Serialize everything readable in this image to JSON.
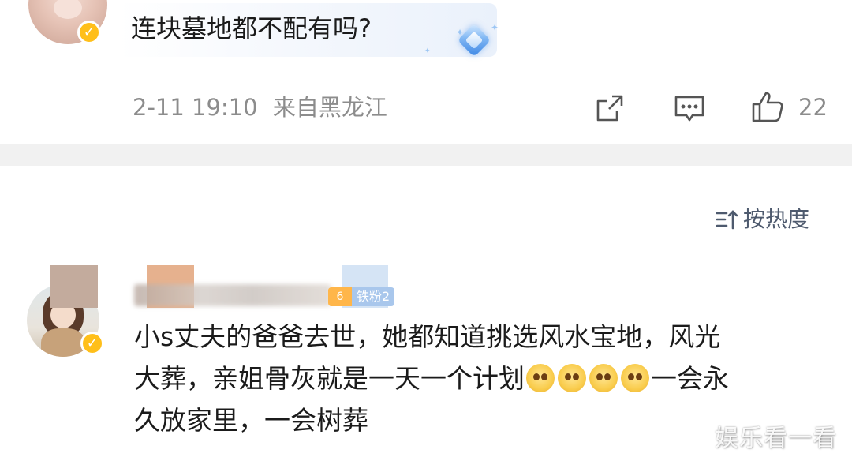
{
  "top_comment": {
    "text": "连块墓地都不配有吗?",
    "time": "2-11 19:10",
    "location": "来自黑龙江",
    "like_count": "22",
    "icons": [
      "share-icon",
      "comment-icon",
      "like-icon"
    ]
  },
  "sort": {
    "label": "按热度",
    "icon": "sort-icon"
  },
  "second_comment": {
    "fan_level": "6",
    "fan_badge": "铁粉2",
    "line1": "小s丈夫的爸爸去世，她都知道挑选风水宝地，风光",
    "line2_before": "大葬，亲姐骨灰就是一天一个计划",
    "line2_after": "一会永",
    "line3": "久放家里，一会树葬",
    "emoji_count": 4
  },
  "watermark": "娱乐看一看",
  "colors": {
    "meta_gray": "#8c8c8c",
    "sort_text": "#4e5a6e",
    "verified_badge": "#ffbf1a",
    "fan_badge": "#a9c7ec",
    "divider": "#f1f1f1"
  }
}
